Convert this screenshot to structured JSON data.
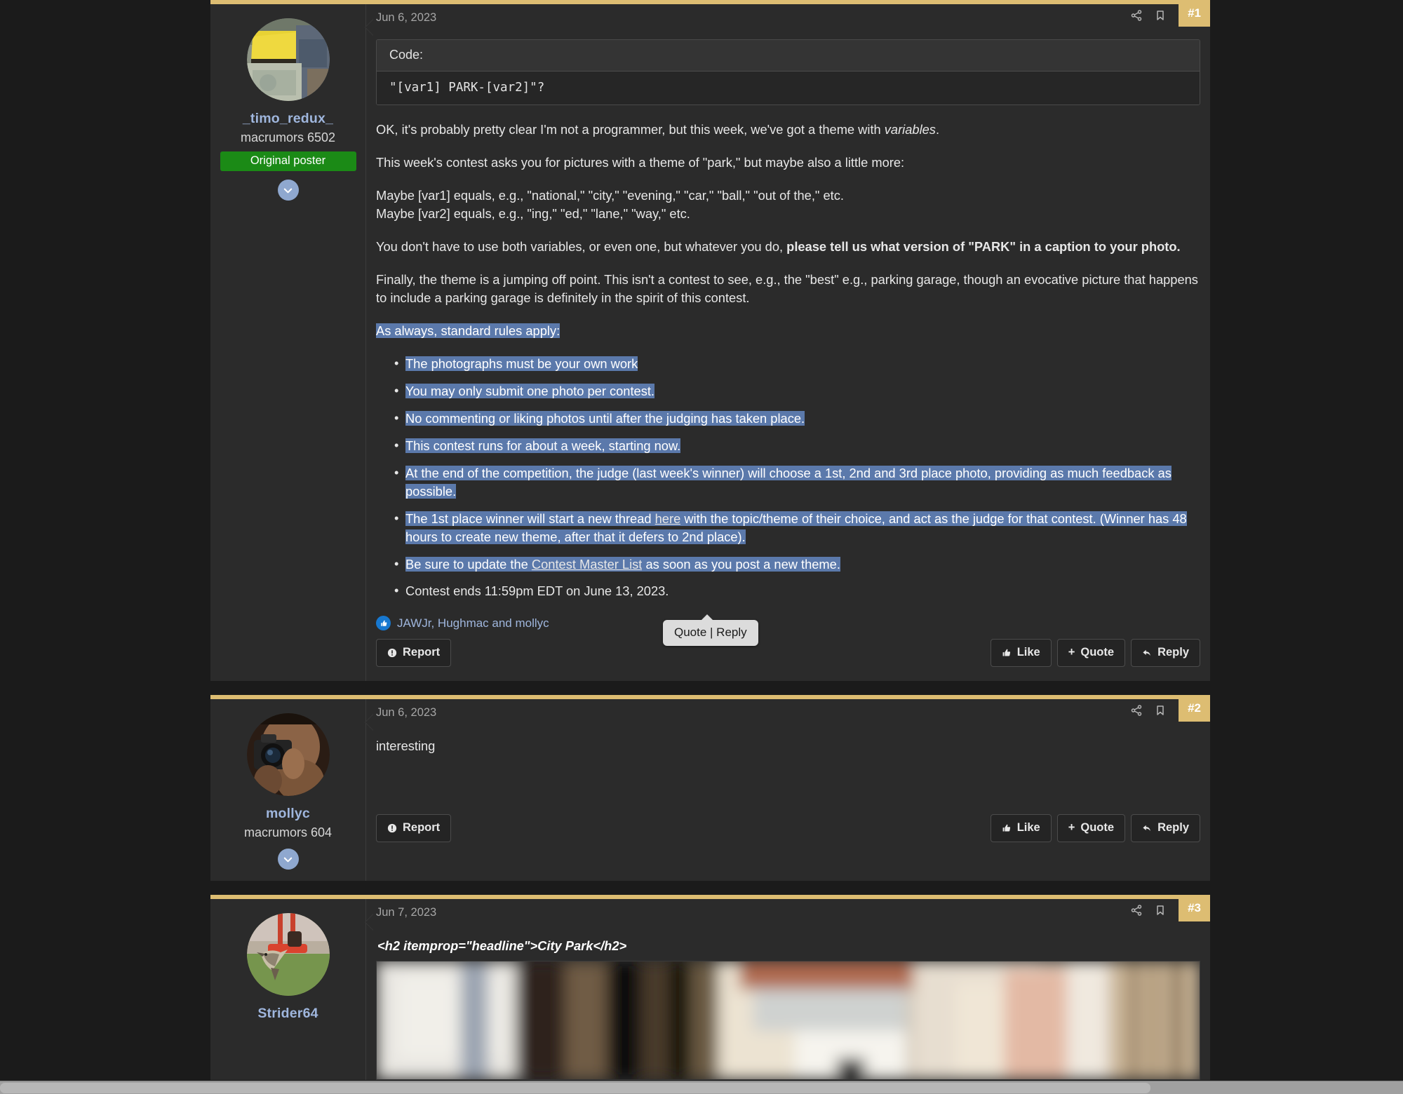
{
  "theme": {
    "page_bg": "#1b1b1b",
    "post_bg": "#2b2b2b",
    "accent_gold": "#ddbd72",
    "link_blue": "#9fb6dd",
    "selection_blue": "#5b79ab",
    "op_badge_green": "#1b8a16",
    "reaction_blue": "#1778d0"
  },
  "tooltip": {
    "label": "Quote | Reply"
  },
  "posts": [
    {
      "number": "#1",
      "date": "Jun 6, 2023",
      "author": {
        "name": "_timo_redux_",
        "title": "macrumors 6502",
        "badge": "Original poster"
      },
      "code": {
        "header": "Code:",
        "content": "\"[var1] PARK-[var2]\"?"
      },
      "paragraphs": {
        "p1_a": "OK, it's probably pretty clear I'm not a programmer, but this week, we've got a theme with ",
        "p1_em": "variables",
        "p1_b": ".",
        "p2": "This week's contest asks you for pictures with a theme of \"park,\" but maybe also a little more:",
        "p3_line1": "Maybe [var1] equals, e.g., \"national,\" \"city,\" \"evening,\" \"car,\" \"ball,\" \"out of the,\" etc.",
        "p3_line2": "Maybe [var2] equals, e.g., \"ing,\" \"ed,\" \"lane,\" \"way,\" etc.",
        "p4_a": "You don't have to use both variables, or even one, but whatever you do, ",
        "p4_bold": "please tell us what version of \"PARK\" in a caption to your photo.",
        "p5": "Finally, the theme is a jumping off point. This isn't a contest to see, e.g., the \"best\" e.g., parking garage, though an evocative picture that happens to include a parking garage is definitely in the spirit of this contest.",
        "rules_intro": "As always, standard rules apply:"
      },
      "rules": [
        {
          "text": "The photographs must be your own work",
          "selected": true
        },
        {
          "text": "You may only submit one photo per contest.",
          "selected": true
        },
        {
          "text": "No commenting or liking photos until after the judging has taken place.",
          "selected": true
        },
        {
          "text": "This contest runs for about a week, starting now.",
          "selected": true
        },
        {
          "text": "At the end of the competition, the judge (last week's winner) will choose a 1st, 2nd and 3rd place photo, providing as much feedback as possible.",
          "selected": true
        },
        {
          "text_a": "The 1st place winner will start a new thread ",
          "link": "here",
          "text_b": " with the topic/theme of their choice, and act as the judge for that contest. (Winner has 48 hours to create new theme, after that it defers to 2nd place).",
          "selected": true
        },
        {
          "text_a": "Be sure to update the ",
          "link": "Contest Master List",
          "text_b": " as soon as you post a new theme.",
          "selected": true
        },
        {
          "text": "Contest ends 11:59pm EDT on June 13, 2023.",
          "selected": false
        }
      ],
      "reactions": {
        "names": "JAWJr, Hughmac and mollyc"
      },
      "actions": {
        "report": "Report",
        "like": "Like",
        "quote": "Quote",
        "quote_prefix": "+",
        "reply": "Reply"
      }
    },
    {
      "number": "#2",
      "date": "Jun 6, 2023",
      "author": {
        "name": "mollyc",
        "title": "macrumors 604"
      },
      "body": "interesting",
      "actions": {
        "report": "Report",
        "like": "Like",
        "quote": "Quote",
        "quote_prefix": "+",
        "reply": "Reply"
      }
    },
    {
      "number": "#3",
      "date": "Jun 7, 2023",
      "author": {
        "name": "Strider64"
      },
      "headline": "<h2 itemprop=\"headline\">City Park</h2>"
    }
  ],
  "icons": {
    "share": "share-icon",
    "bookmark": "bookmark-icon",
    "chevron_down": "chevron-down-icon",
    "report": "exclamation-circle-icon",
    "like": "thumbs-up-icon",
    "reply": "reply-arrow-icon"
  }
}
